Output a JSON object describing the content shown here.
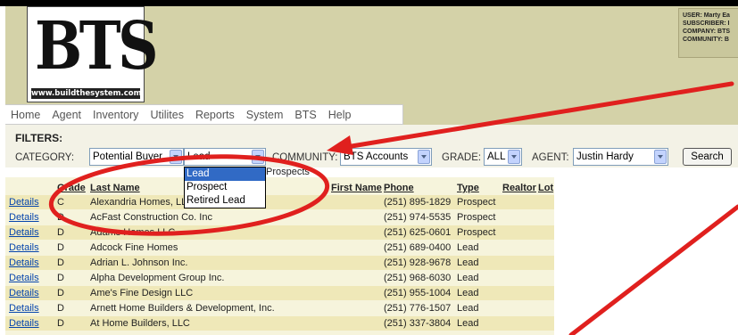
{
  "logo": {
    "letters": "BTS",
    "url": "www.buildthesystem.com"
  },
  "user_info": [
    "USER: Marty Ea",
    "SUBSCRIBER: I",
    "COMPANY: BTS",
    "COMMUNITY: B"
  ],
  "nav": [
    "Home",
    "Agent",
    "Inventory",
    "Utilites",
    "Reports",
    "System",
    "BTS",
    "Help"
  ],
  "filters": {
    "title": "FILTERS:",
    "category_label": "CATEGORY:",
    "category_value": "Potential Buyer",
    "status_value": "Lead",
    "community_label": "COMMUNITY:",
    "community_value": "BTS Accounts",
    "grade_label": "GRADE:",
    "grade_value": "ALL",
    "agent_label": "AGENT:",
    "agent_value": "Justin Hardy",
    "search_label": "Search",
    "subtext": "Prospects"
  },
  "status_dropdown": [
    "Lead",
    "Prospect",
    "Retired Lead"
  ],
  "table": {
    "headers": {
      "grade": "Grade",
      "last_name": "Last Name",
      "first_name": "First Name",
      "phone": "Phone",
      "type": "Type",
      "realtor": "Realtor",
      "lot": "Lot"
    },
    "details_label": "Details",
    "rows": [
      {
        "grade": "C",
        "name": "Alexandria Homes, LLC",
        "phone": "(251) 895-1829",
        "type": "Prospect"
      },
      {
        "grade": "D",
        "name": "AcFast Construction Co. Inc",
        "phone": "(251) 974-5535",
        "type": "Prospect"
      },
      {
        "grade": "D",
        "name": "Adams Homes LLC",
        "phone": "(251) 625-0601",
        "type": "Prospect"
      },
      {
        "grade": "D",
        "name": "Adcock Fine Homes",
        "phone": "(251) 689-0400",
        "type": "Lead"
      },
      {
        "grade": "D",
        "name": "Adrian L. Johnson Inc.",
        "phone": "(251) 928-9678",
        "type": "Lead"
      },
      {
        "grade": "D",
        "name": "Alpha Development Group Inc.",
        "phone": "(251) 968-6030",
        "type": "Lead"
      },
      {
        "grade": "D",
        "name": "Ame's Fine Design LLC",
        "phone": "(251) 955-1004",
        "type": "Lead"
      },
      {
        "grade": "D",
        "name": "Arnett Home Builders & Development, Inc.",
        "phone": "(251) 776-1507",
        "type": "Lead"
      },
      {
        "grade": "D",
        "name": "At Home Builders, LLC",
        "phone": "(251) 337-3804",
        "type": "Lead"
      }
    ]
  },
  "colors": {
    "header_bg": "#d4d2a8",
    "row_alt": "#efe8b8",
    "annotation_red": "#e0201e",
    "link": "#0645ad"
  }
}
